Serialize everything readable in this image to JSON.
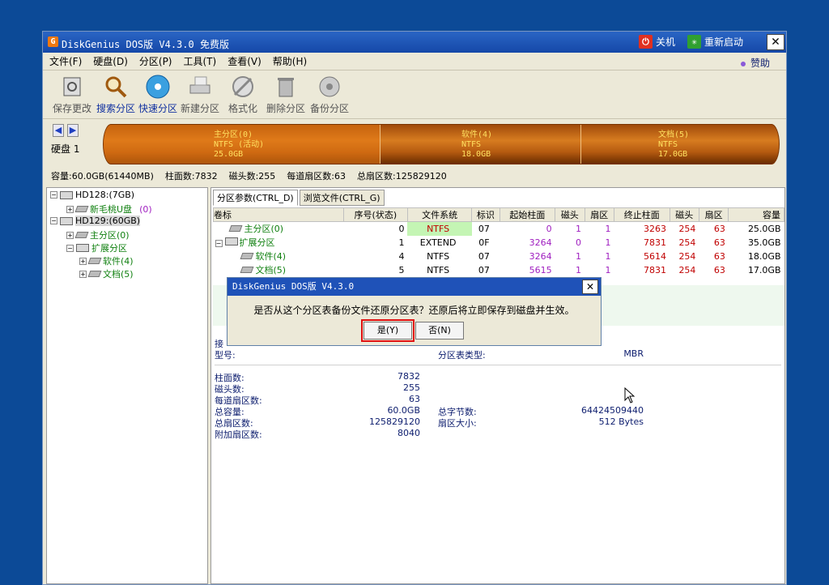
{
  "window": {
    "title": "DiskGenius DOS版 V4.3.0 免费版",
    "shutdown_label": "关机",
    "restart_label": "重新启动",
    "close_glyph": "✕"
  },
  "menu": [
    "文件(F)",
    "硬盘(D)",
    "分区(P)",
    "工具(T)",
    "查看(V)",
    "帮助(H)"
  ],
  "donate_label": "赞助",
  "toolbar": [
    {
      "label": "保存更改",
      "icon": "save-icon",
      "active": false
    },
    {
      "label": "搜索分区",
      "icon": "search-icon",
      "active": true
    },
    {
      "label": "快速分区",
      "icon": "quick-partition-icon",
      "active": true
    },
    {
      "label": "新建分区",
      "icon": "new-partition-icon",
      "active": false
    },
    {
      "label": "格式化",
      "icon": "format-icon",
      "active": false
    },
    {
      "label": "删除分区",
      "icon": "delete-icon",
      "active": false
    },
    {
      "label": "备份分区",
      "icon": "backup-icon",
      "active": false
    }
  ],
  "disk_map": {
    "disk_label": "硬盘 1",
    "segments": [
      {
        "name": "主分区(0)",
        "fs": "NTFS (活动)",
        "size": "25.0GB"
      },
      {
        "name": "软件(4)",
        "fs": "NTFS",
        "size": "18.0GB"
      },
      {
        "name": "文档(5)",
        "fs": "NTFS",
        "size": "17.0GB"
      }
    ]
  },
  "disk_info": {
    "capacity": "容量:60.0GB(61440MB)",
    "cylinders": "柱面数:7832",
    "heads": "磁头数:255",
    "sectors_per_track": "每道扇区数:63",
    "total_sectors": "总扇区数:125829120"
  },
  "tree": {
    "hd128": "HD128:(7GB)",
    "usb": "新毛桃U盘",
    "usb_num": "(0)",
    "hd129": "HD129:(60GB)",
    "primary": "主分区(0)",
    "extended": "扩展分区",
    "soft": "软件(4)",
    "docs": "文档(5)"
  },
  "tabs": [
    "分区参数(CTRL_D)",
    "浏览文件(CTRL_G)"
  ],
  "table": {
    "headers": [
      "卷标",
      "序号(状态)",
      "文件系统",
      "标识",
      "起始柱面",
      "磁头",
      "扇区",
      "终止柱面",
      "磁头",
      "扇区",
      "容量"
    ],
    "rows": [
      [
        "主分区(0)",
        "0",
        "NTFS",
        "07",
        "0",
        "1",
        "1",
        "3263",
        "254",
        "63",
        "25.0GB"
      ],
      [
        "扩展分区",
        "1",
        "EXTEND",
        "0F",
        "3264",
        "0",
        "1",
        "7831",
        "254",
        "63",
        "35.0GB"
      ],
      [
        "软件(4)",
        "4",
        "NTFS",
        "07",
        "3264",
        "1",
        "1",
        "5614",
        "254",
        "63",
        "18.0GB"
      ],
      [
        "文档(5)",
        "5",
        "NTFS",
        "07",
        "5615",
        "1",
        "1",
        "7831",
        "254",
        "63",
        "17.0GB"
      ]
    ]
  },
  "details": {
    "interface_partial": "接",
    "model_label": "型号:",
    "pt_type_label": "分区表类型:",
    "pt_type": "MBR",
    "cylinders_label": "柱面数:",
    "cylinders": "7832",
    "heads_label": "磁头数:",
    "heads": "255",
    "spt_label": "每道扇区数:",
    "spt": "63",
    "capacity_label": "总容量:",
    "capacity": "60.0GB",
    "bytes_label": "总字节数:",
    "bytes": "64424509440",
    "sectors_label": "总扇区数:",
    "sectors": "125829120",
    "sector_size_label": "扇区大小:",
    "sector_size": "512 Bytes",
    "extra_label": "附加扇区数:",
    "extra": "8040"
  },
  "dialog": {
    "title": "DiskGenius DOS版 V4.3.0",
    "message": "是否从这个分区表备份文件还原分区表？还原后将立即保存到磁盘并生效。",
    "yes": "是(Y)",
    "no": "否(N)"
  }
}
